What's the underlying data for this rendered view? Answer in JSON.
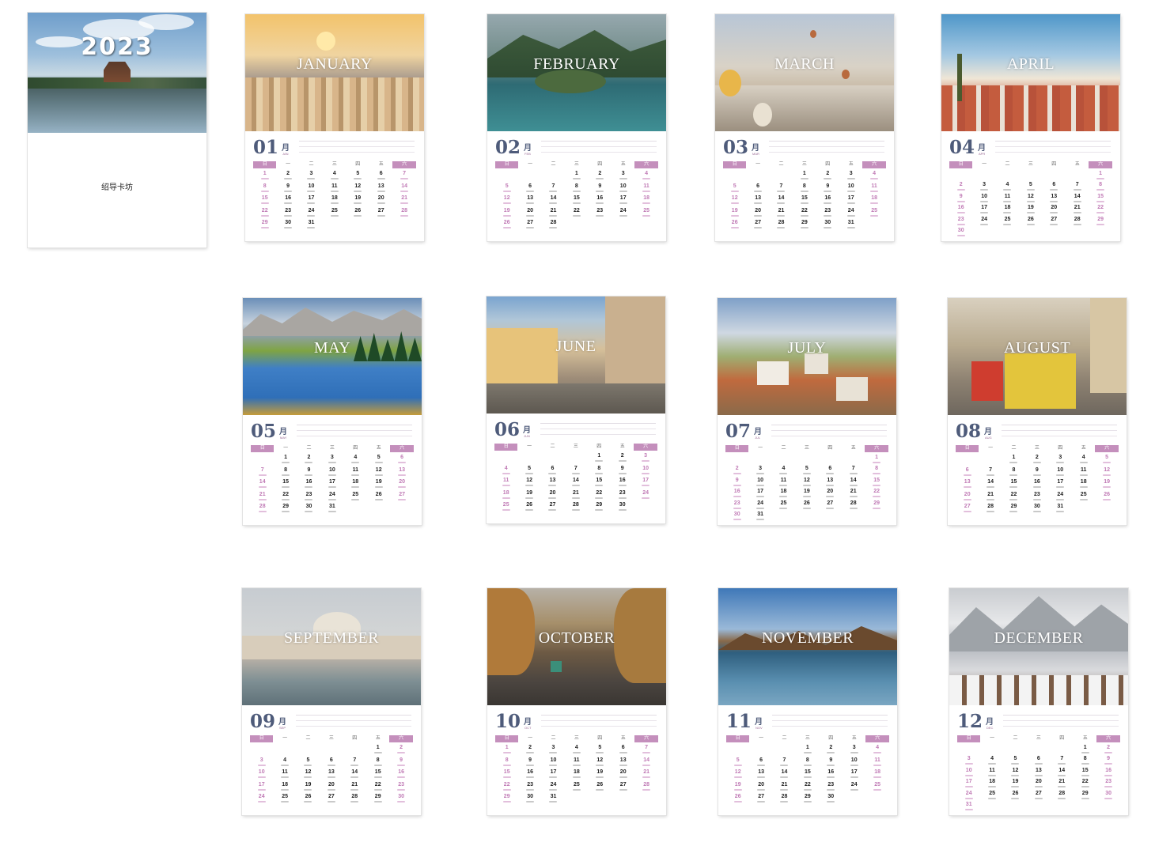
{
  "cover": {
    "year": "2023",
    "caption": "绍导卡坊"
  },
  "weekdays": [
    "日",
    "一",
    "二",
    "三",
    "四",
    "五",
    "六"
  ],
  "month_suffix": "月",
  "colors": {
    "accent": "#c48fbc",
    "number": "#4e5b7a",
    "holiday_text": "#c07ab5"
  },
  "months": [
    {
      "num": "01",
      "name": "JANUARY",
      "abbr": "JAN",
      "offset": 0,
      "days": 31
    },
    {
      "num": "02",
      "name": "FEBRUARY",
      "abbr": "FEB",
      "offset": 3,
      "days": 28
    },
    {
      "num": "03",
      "name": "MARCH",
      "abbr": "MAR",
      "offset": 3,
      "days": 31
    },
    {
      "num": "04",
      "name": "APRIL",
      "abbr": "APR",
      "offset": 6,
      "days": 30
    },
    {
      "num": "05",
      "name": "MAY",
      "abbr": "MAY",
      "offset": 1,
      "days": 31
    },
    {
      "num": "06",
      "name": "JUNE",
      "abbr": "JUN",
      "offset": 4,
      "days": 30
    },
    {
      "num": "07",
      "name": "JULY",
      "abbr": "JUL",
      "offset": 6,
      "days": 31
    },
    {
      "num": "08",
      "name": "AUGUST",
      "abbr": "AUG",
      "offset": 2,
      "days": 31
    },
    {
      "num": "09",
      "name": "SEPTEMBER",
      "abbr": "SEP",
      "offset": 5,
      "days": 30
    },
    {
      "num": "10",
      "name": "OCTOBER",
      "abbr": "OCT",
      "offset": 0,
      "days": 31
    },
    {
      "num": "11",
      "name": "NOVEMBER",
      "abbr": "NOV",
      "offset": 3,
      "days": 30
    },
    {
      "num": "12",
      "name": "DECEMBER",
      "abbr": "DEC",
      "offset": 5,
      "days": 31
    }
  ]
}
